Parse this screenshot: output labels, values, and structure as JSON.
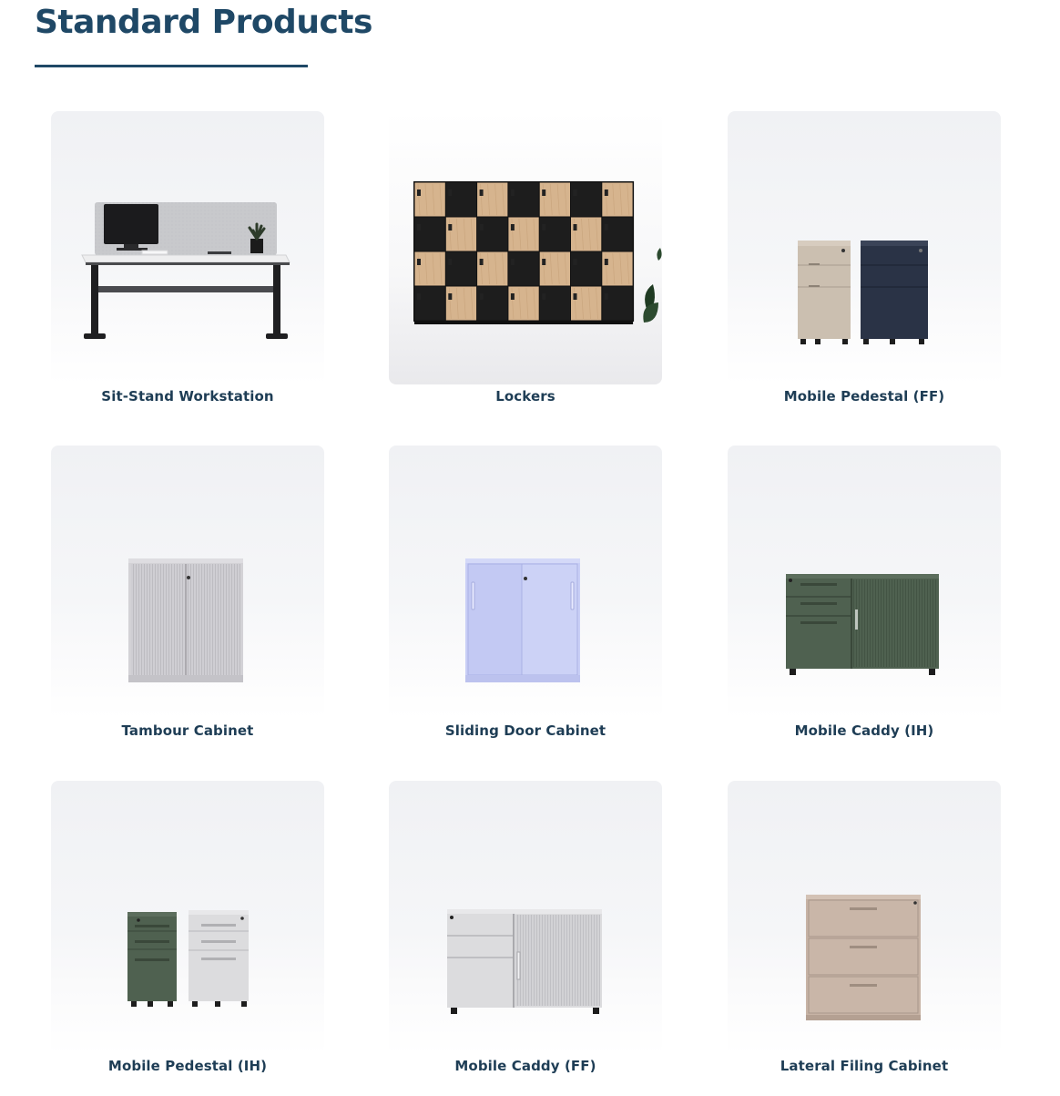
{
  "page": {
    "title": "Standard Products"
  },
  "products": [
    {
      "name": "Sit-Stand Workstation",
      "icon": "sit-stand-workstation-image"
    },
    {
      "name": "Lockers",
      "icon": "lockers-image"
    },
    {
      "name": "Mobile Pedestal (FF)",
      "icon": "mobile-pedestal-ff-image"
    },
    {
      "name": "Tambour Cabinet",
      "icon": "tambour-cabinet-image"
    },
    {
      "name": "Sliding Door Cabinet",
      "icon": "sliding-door-cabinet-image"
    },
    {
      "name": "Mobile Caddy (IH)",
      "icon": "mobile-caddy-ih-image"
    },
    {
      "name": "Mobile Pedestal (IH)",
      "icon": "mobile-pedestal-ih-image"
    },
    {
      "name": "Mobile Caddy (FF)",
      "icon": "mobile-caddy-ff-image"
    },
    {
      "name": "Lateral Filing Cabinet",
      "icon": "lateral-filing-cabinet-image"
    }
  ],
  "colors": {
    "heading": "#1f4866",
    "label": "#1e3d55",
    "oak": "#d6b48e",
    "locker_black": "#1d1d1d",
    "beige": "#cbbfb0",
    "navy": "#2a3346",
    "olive": "#4f6150",
    "lilac": "#c9cff6",
    "light_grey": "#dcdcde",
    "taupe": "#c7b3a5"
  }
}
